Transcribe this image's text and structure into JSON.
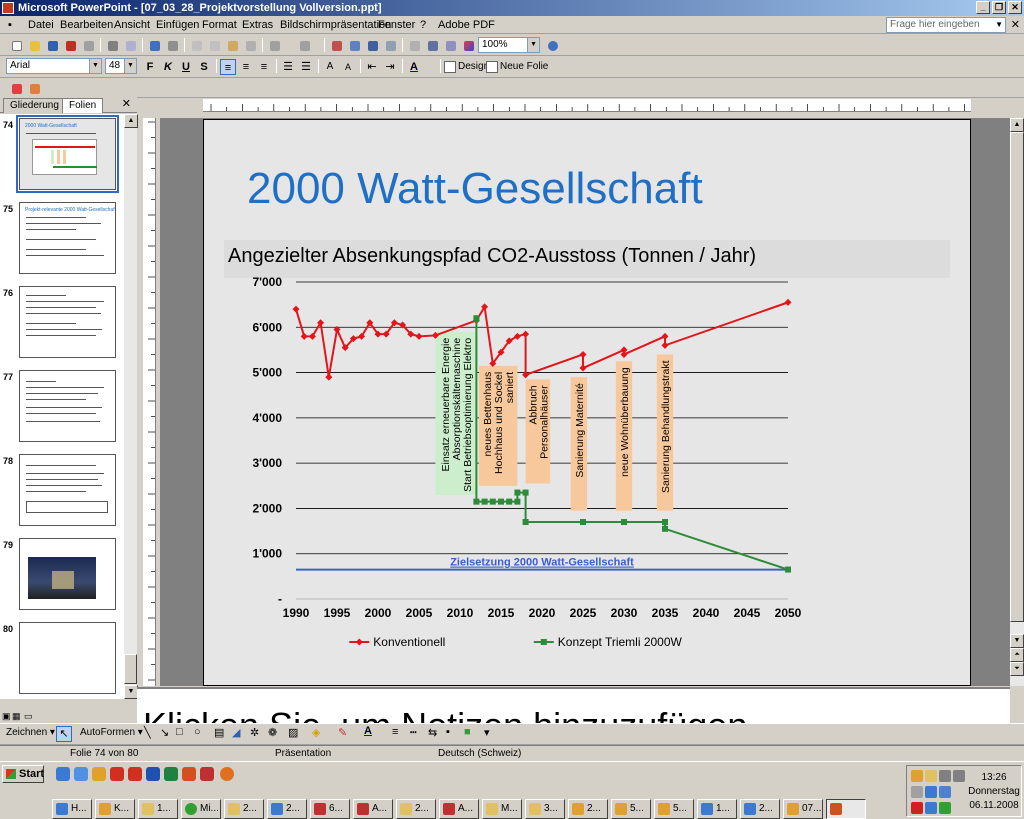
{
  "window": {
    "title": "Microsoft PowerPoint - [07_03_28_Projektvorstellung Vollversion.ppt]"
  },
  "menu": {
    "items": [
      "Datei",
      "Bearbeiten",
      "Ansicht",
      "Einfügen",
      "Format",
      "Extras",
      "Bildschirmpräsentation",
      "Fenster",
      "?",
      "Adobe PDF"
    ],
    "help_placeholder": "Frage hier eingeben"
  },
  "toolbar": {
    "zoom": "100%",
    "font": "Arial",
    "size": "48",
    "bold": "F",
    "italic": "K",
    "underline": "U",
    "shadow": "S",
    "design": "Design",
    "new_slide": "Neue Folie"
  },
  "panel": {
    "tab_outline": "Gliederung",
    "tab_slides": "Folien",
    "close": "✕"
  },
  "thumbnails": [
    {
      "num": "74",
      "title": "2000 Watt-Gesellschaft"
    },
    {
      "num": "75",
      "title": "Projekt-relevante 2000 Watt-Gesellschaft"
    },
    {
      "num": "76",
      "title": ""
    },
    {
      "num": "77",
      "title": ""
    },
    {
      "num": "78",
      "title": ""
    },
    {
      "num": "79",
      "title": ""
    },
    {
      "num": "80",
      "title": ""
    }
  ],
  "slide": {
    "title": "2000 Watt-Gesellschaft",
    "chart_title": "Angezielter Absenkungspfad CO2-Ausstoss (Tonnen / Jahr)"
  },
  "chart_data": {
    "type": "line",
    "title": "Angezielter Absenkungspfad CO2-Ausstoss (Tonnen / Jahr)",
    "xlim": [
      1990,
      2050
    ],
    "ylim": [
      0,
      7000
    ],
    "x_ticks": [
      "1990",
      "1995",
      "2000",
      "2005",
      "2010",
      "2015",
      "2020",
      "2025",
      "2030",
      "2035",
      "2040",
      "2045",
      "2050"
    ],
    "y_ticks": [
      "-",
      "1'000",
      "2'000",
      "3'000",
      "4'000",
      "5'000",
      "6'000",
      "7'000"
    ],
    "series": [
      {
        "name": "Konventionell",
        "color": "#e3151a",
        "x": [
          1990,
          1991,
          1992,
          1993,
          1994,
          1995,
          1996,
          1997,
          1998,
          1999,
          2000,
          2001,
          2002,
          2003,
          2004,
          2005,
          2007,
          2012,
          2013,
          2014,
          2015,
          2016,
          2017,
          2018,
          2018,
          2025,
          2025,
          2030,
          2030,
          2035,
          2035,
          2050
        ],
        "y": [
          6400,
          5800,
          5800,
          6100,
          4900,
          5950,
          5550,
          5750,
          5800,
          6100,
          5850,
          5850,
          6100,
          6050,
          5850,
          5800,
          5820,
          6150,
          6450,
          5200,
          5450,
          5700,
          5800,
          5850,
          4950,
          5400,
          5100,
          5500,
          5400,
          5800,
          5600,
          6550
        ]
      },
      {
        "name": "Konzept Triemli 2000W",
        "color": "#2e8b3a",
        "x": [
          2012,
          2012,
          2013,
          2014,
          2015,
          2016,
          2017,
          2017,
          2018,
          2018,
          2025,
          2030,
          2035,
          2035,
          2050
        ],
        "y": [
          6200,
          2150,
          2150,
          2150,
          2150,
          2150,
          2150,
          2350,
          2350,
          1700,
          1700,
          1700,
          1700,
          1550,
          650
        ]
      }
    ],
    "target": {
      "label": "Zielsetzung 2000 Watt-Gesellschaft",
      "value": 650,
      "color": "#3a5fcd"
    },
    "annotations": [
      {
        "label": "Einsatz erneuerbare Energie Absorptionskältemaschine Start Betriebsoptimierung Elektro",
        "x0": 2007,
        "x1": 2012,
        "y0": 2300,
        "y1": 5900,
        "color": "#cceecc"
      },
      {
        "label": "neues Bettenhaus Hochhaus und Sockel saniert",
        "x0": 2012.3,
        "x1": 2017,
        "y0": 2500,
        "y1": 5150,
        "color": "#f7c89b"
      },
      {
        "label": "Abbruch Personalhäuser",
        "x0": 2018,
        "x1": 2021,
        "y0": 2550,
        "y1": 4850,
        "color": "#f7c89b"
      },
      {
        "label": "Sanierung Maternité",
        "x0": 2023.5,
        "x1": 2025.5,
        "y0": 1950,
        "y1": 4900,
        "color": "#f7c89b"
      },
      {
        "label": "neue Wohnüberbauung",
        "x0": 2029,
        "x1": 2031,
        "y0": 1950,
        "y1": 5250,
        "color": "#f7c89b"
      },
      {
        "label": "Sanierung Behandlungstrakt",
        "x0": 2034,
        "x1": 2036,
        "y0": 1950,
        "y1": 5400,
        "color": "#f7c89b"
      }
    ],
    "legend": "bottom"
  },
  "notes": {
    "placeholder": "Klicken Sie, um Notizen hinzuzufügen"
  },
  "drawing": {
    "draw": "Zeichnen",
    "autoshapes": "AutoFormen"
  },
  "status": {
    "slide": "Folie 74 von 80",
    "design": "Präsentation",
    "language": "Deutsch (Schweiz)"
  },
  "taskbar": {
    "start": "Start",
    "tasks": [
      "H...",
      "K...",
      "1...",
      "Mi...",
      "2...",
      "2...",
      "6...",
      "A...",
      "2...",
      "A...",
      "M...",
      "3...",
      "2...",
      "5...",
      "5...",
      "1...",
      "2...",
      "07..."
    ],
    "time": "13:26",
    "day": "Donnerstag",
    "date": "06.11.2008"
  }
}
